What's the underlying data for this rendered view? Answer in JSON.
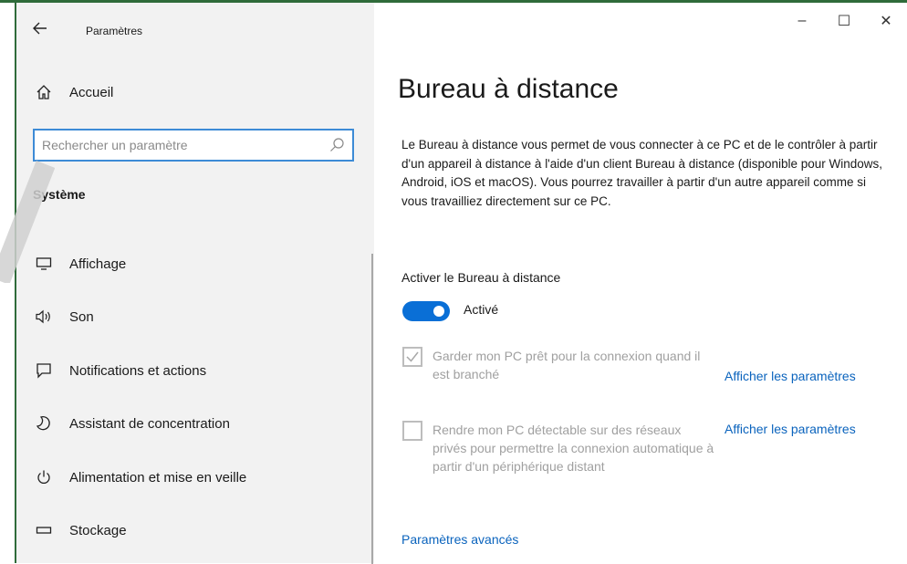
{
  "window": {
    "app_title": "Paramètres",
    "back_icon": "back-arrow-icon",
    "controls": {
      "minimize": "–",
      "maximize": "☐",
      "close": "✕"
    }
  },
  "sidebar": {
    "home": {
      "label": "Accueil",
      "icon": "home-icon"
    },
    "search": {
      "placeholder": "Rechercher un paramètre",
      "value": "",
      "icon": "search-icon"
    },
    "section_title": "Système",
    "items": [
      {
        "label": "Affichage",
        "icon": "display-icon"
      },
      {
        "label": "Son",
        "icon": "speaker-icon"
      },
      {
        "label": "Notifications et actions",
        "icon": "notification-icon"
      },
      {
        "label": "Assistant de concentration",
        "icon": "moon-icon"
      },
      {
        "label": "Alimentation et mise en veille",
        "icon": "power-icon"
      },
      {
        "label": "Stockage",
        "icon": "storage-icon"
      }
    ]
  },
  "main": {
    "title": "Bureau à distance",
    "description": "Le Bureau à distance vous permet de vous connecter à ce PC et de le contrôler à partir d'un appareil à distance à l'aide d'un client Bureau à distance (disponible pour Windows, Android, iOS et macOS). Vous pourrez travailler à partir d'un autre appareil comme si vous travailliez directement sur ce PC.",
    "toggle": {
      "label": "Activer le Bureau à distance",
      "state_label": "Activé",
      "on": true
    },
    "options": [
      {
        "text": "Garder mon PC prêt pour la connexion quand il est branché",
        "checked": true,
        "link": "Afficher les paramètres"
      },
      {
        "text": "Rendre mon PC détectable sur des réseaux privés pour permettre la connexion automatique à partir d'un périphérique distant",
        "checked": false,
        "link": "Afficher les paramètres"
      }
    ],
    "advanced_link": "Paramètres avancés"
  },
  "colors": {
    "accent": "#0a6fd6",
    "link": "#0a63bd",
    "sidebar_bg": "#f2f2f2",
    "frame": "#2f6b3a"
  }
}
